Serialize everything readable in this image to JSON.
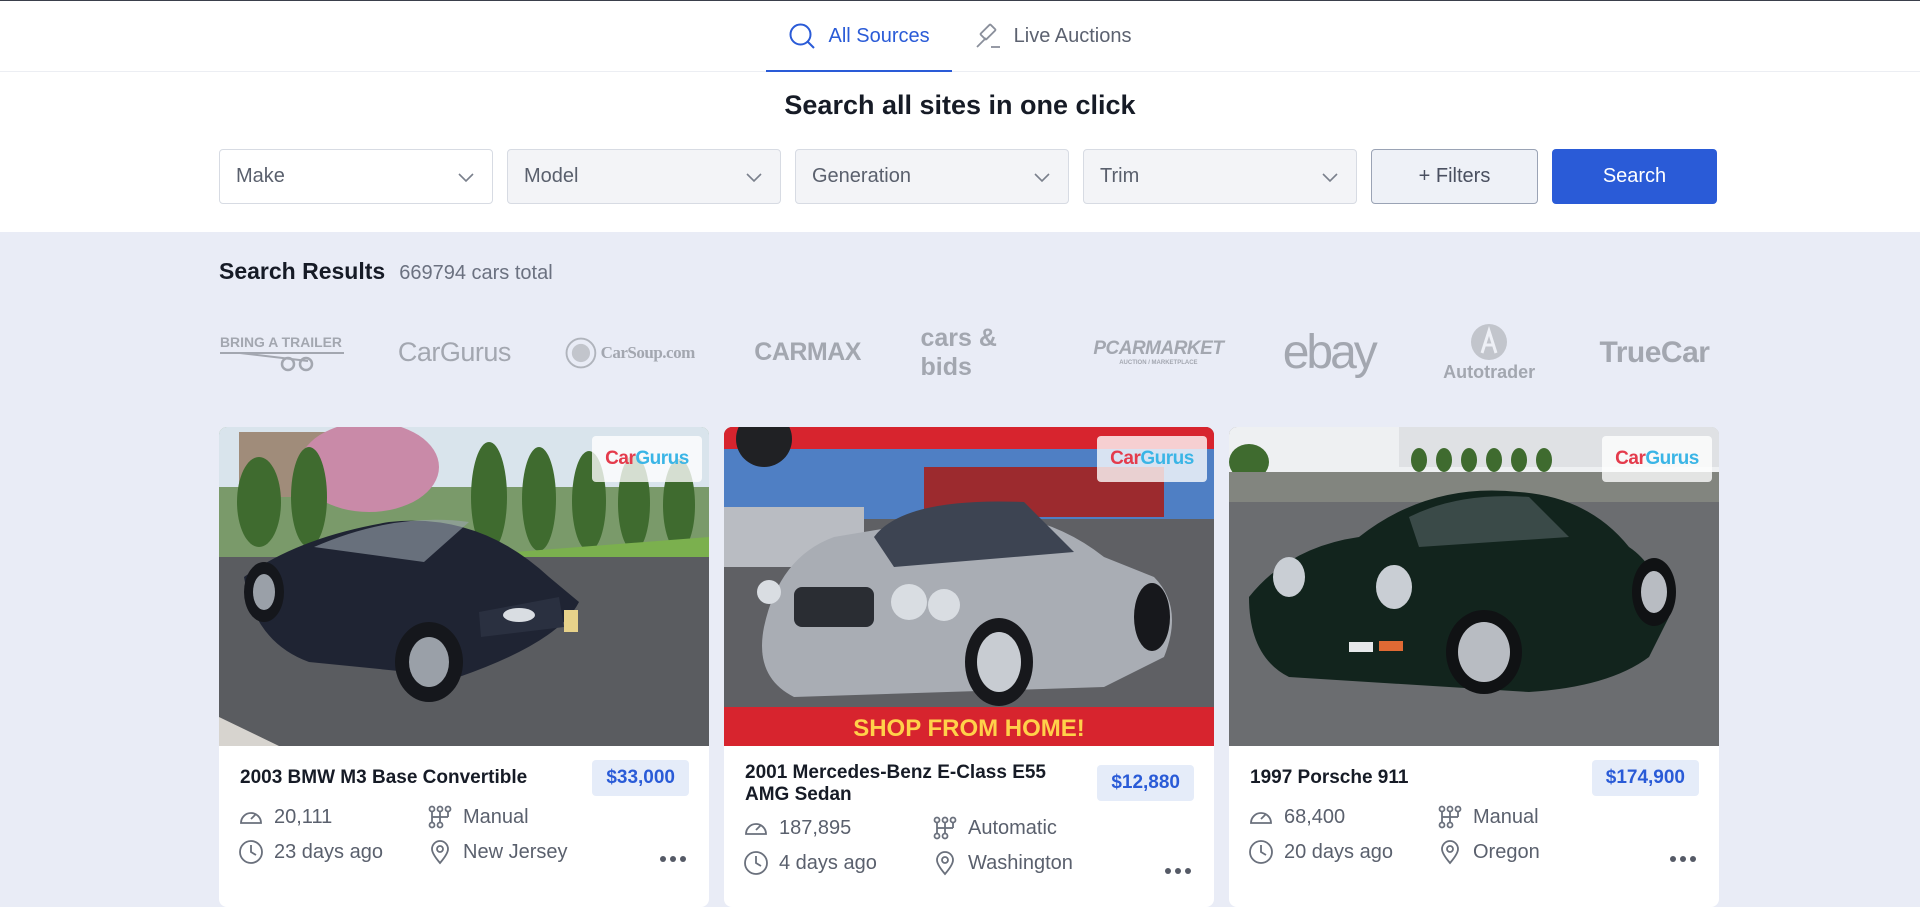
{
  "tabs": [
    {
      "label": "All Sources",
      "icon": "search-icon",
      "active": true
    },
    {
      "label": "Live Auctions",
      "icon": "gavel-icon",
      "active": false
    }
  ],
  "search": {
    "title": "Search all sites in one click",
    "selects": [
      {
        "label": "Make",
        "enabled": true
      },
      {
        "label": "Model",
        "enabled": false
      },
      {
        "label": "Generation",
        "enabled": false
      },
      {
        "label": "Trim",
        "enabled": false
      }
    ],
    "filters_label": "+ Filters",
    "search_label": "Search"
  },
  "results": {
    "title": "Search Results",
    "count": "669794 cars total"
  },
  "sources": [
    {
      "name": "BRING A TRAILER"
    },
    {
      "name": "CarGurus"
    },
    {
      "name": "CarSoup.com"
    },
    {
      "name": "CARMAX"
    },
    {
      "name": "cars & bids"
    },
    {
      "name": "PCARMARKET",
      "tagline": "AUCTION / MARKETPLACE"
    },
    {
      "name": "ebay"
    },
    {
      "name": "Autotrader"
    },
    {
      "name": "TrueCar"
    }
  ],
  "cards": [
    {
      "title": "2003 BMW M3 Base Convertible",
      "price": "$33,000",
      "mileage": "20,111",
      "transmission": "Manual",
      "listed": "23 days ago",
      "location": "New Jersey",
      "source": "CarGurus"
    },
    {
      "title": "2001 Mercedes-Benz E-Class E55 AMG Sedan",
      "price": "$12,880",
      "mileage": "187,895",
      "transmission": "Automatic",
      "listed": "4 days ago",
      "location": "Washington",
      "source": "CarGurus",
      "photo_banner": "SHOP FROM HOME!"
    },
    {
      "title": "1997 Porsche 911",
      "price": "$174,900",
      "mileage": "68,400",
      "transmission": "Manual",
      "listed": "20 days ago",
      "location": "Oregon",
      "source": "CarGurus"
    }
  ],
  "colors": {
    "accent": "#2a5bd7",
    "page_bg": "#e9ecf6",
    "price_bg": "#e5ecf9",
    "cargurus_red": "#e43b4c",
    "cargurus_blue": "#3ab5e6"
  }
}
